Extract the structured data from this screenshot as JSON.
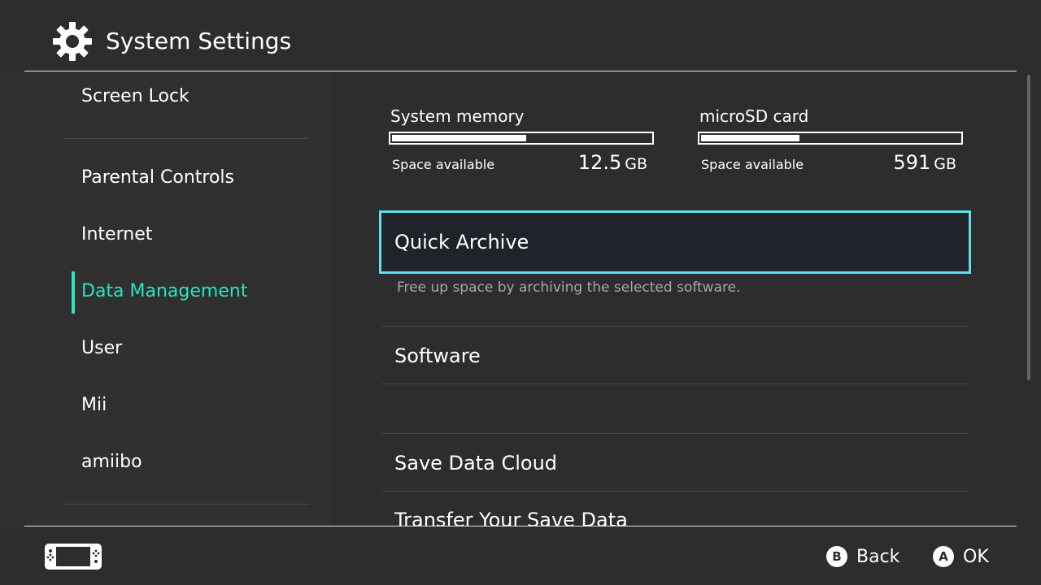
{
  "header": {
    "title": "System Settings",
    "icon": "gear-icon"
  },
  "sidebar": {
    "items": [
      {
        "label": "Screen Lock"
      },
      {
        "label": "Parental Controls"
      },
      {
        "label": "Internet"
      },
      {
        "label": "Data Management",
        "active": true
      },
      {
        "label": "User"
      },
      {
        "label": "Mii"
      },
      {
        "label": "amiibo"
      }
    ]
  },
  "storage": {
    "system": {
      "label": "System memory",
      "available_label": "Space available",
      "amount": "12.5",
      "unit": "GB",
      "used_fraction": 0.52
    },
    "sd": {
      "label": "microSD card",
      "available_label": "Space available",
      "amount": "591",
      "unit": "GB",
      "used_fraction": 0.38
    }
  },
  "menu": {
    "items": [
      {
        "label": "Quick Archive",
        "description": "Free up space by archiving the selected software.",
        "selected": true
      },
      {
        "label": "Software"
      },
      {
        "label": ""
      },
      {
        "label": "Save Data Cloud"
      },
      {
        "label": "Transfer Your Save Data"
      }
    ]
  },
  "footer": {
    "back": {
      "key": "B",
      "label": "Back"
    },
    "ok": {
      "key": "A",
      "label": "OK"
    }
  },
  "colors": {
    "background": "#2d2d2d",
    "sidebar_bg": "#303030",
    "accent": "#28e6c0",
    "selection_border": "#5fe0ee",
    "selection_bg": "#20232a",
    "text": "#ffffff",
    "muted_text": "#a8a8a8"
  }
}
